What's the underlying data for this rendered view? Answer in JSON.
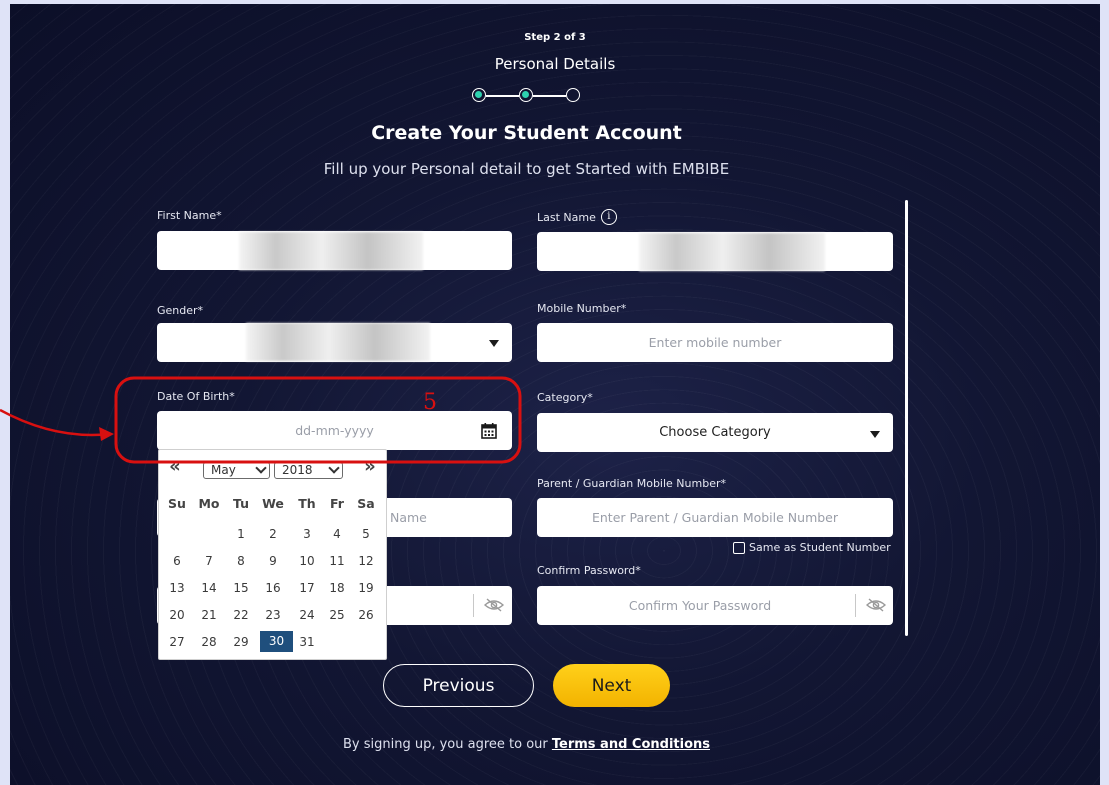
{
  "stepper": {
    "step_text": "Step 2 of 3",
    "step_name": "Personal Details"
  },
  "header": {
    "title": "Create Your Student Account",
    "subtitle": "Fill up your Personal detail to get Started with EMBIBE"
  },
  "form": {
    "first_name_label": "First Name*",
    "last_name_label": "Last Name",
    "gender_label": "Gender*",
    "mobile_label": "Mobile Number*",
    "mobile_placeholder": "Enter mobile number",
    "dob_label": "Date Of Birth*",
    "dob_placeholder": "dd-mm-yyyy",
    "category_label": "Category*",
    "category_value": "Choose Category",
    "hidden_field_partial": "Name",
    "parent_mobile_label": "Parent / Guardian Mobile Number*",
    "parent_mobile_placeholder": "Enter Parent / Guardian Mobile Number",
    "same_as_student": "Same as Student Number",
    "confirm_password_label": "Confirm Password*",
    "confirm_password_placeholder": "Confirm Your Password"
  },
  "calendar": {
    "prev_nav": "«",
    "next_nav": "»",
    "month": "May",
    "year": "2018",
    "weekdays": [
      "Su",
      "Mo",
      "Tu",
      "We",
      "Th",
      "Fr",
      "Sa"
    ],
    "weeks": [
      [
        "",
        "",
        "1",
        "2",
        "3",
        "4",
        "5"
      ],
      [
        "6",
        "7",
        "8",
        "9",
        "10",
        "11",
        "12"
      ],
      [
        "13",
        "14",
        "15",
        "16",
        "17",
        "18",
        "19"
      ],
      [
        "20",
        "21",
        "22",
        "23",
        "24",
        "25",
        "26"
      ],
      [
        "27",
        "28",
        "29",
        "30",
        "31",
        "",
        ""
      ]
    ],
    "selected_day": "30"
  },
  "annotation": {
    "number": "5",
    "color": "#d81010"
  },
  "buttons": {
    "previous": "Previous",
    "next": "Next"
  },
  "footer": {
    "text": "By signing up, you agree to our ",
    "link": "Terms and Conditions"
  },
  "colors": {
    "background": "#121633",
    "accent_yellow": "#f9c10a",
    "stepper_done": "#2ed2b0",
    "calendar_selected": "#1f4f7d"
  }
}
